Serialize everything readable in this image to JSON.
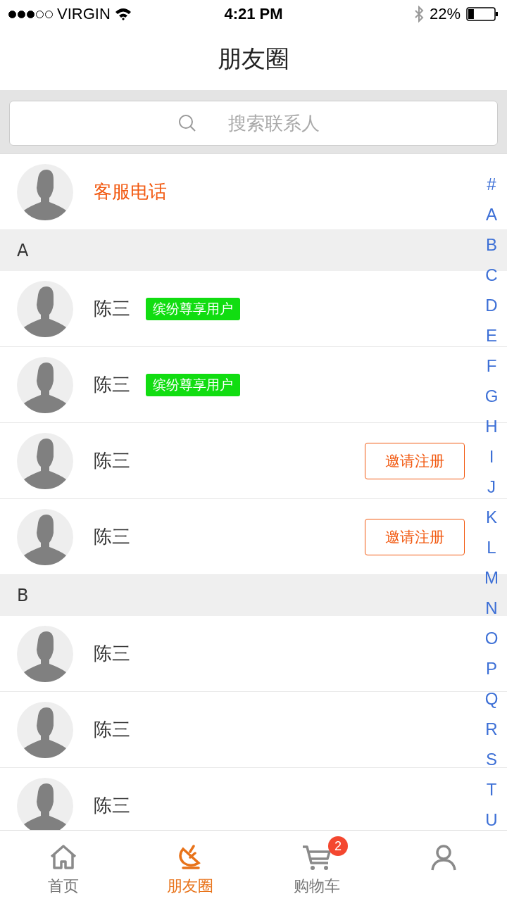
{
  "status_bar": {
    "carrier": "VIRGIN",
    "time": "4:21 PM",
    "battery": "22%"
  },
  "title": "朋友圈",
  "search": {
    "placeholder": "搜索联系人"
  },
  "service": {
    "name": "客服电话"
  },
  "sections": [
    {
      "letter": "A",
      "contacts": [
        {
          "name": "陈三",
          "kind": "member",
          "badge": "缤纷尊享用户"
        },
        {
          "name": "陈三",
          "kind": "member",
          "badge": "缤纷尊享用户"
        },
        {
          "name": "陈三",
          "kind": "invite",
          "button": "邀请注册"
        },
        {
          "name": "陈三",
          "kind": "invite",
          "button": "邀请注册"
        }
      ]
    },
    {
      "letter": "B",
      "contacts": [
        {
          "name": "陈三",
          "kind": "plain"
        },
        {
          "name": "陈三",
          "kind": "plain"
        },
        {
          "name": "陈三",
          "kind": "plain"
        }
      ]
    }
  ],
  "index": [
    "#",
    "A",
    "B",
    "C",
    "D",
    "E",
    "F",
    "G",
    "H",
    "I",
    "J",
    "K",
    "L",
    "M",
    "N",
    "O",
    "P",
    "Q",
    "R",
    "S",
    "T",
    "U"
  ],
  "tabs": [
    {
      "label": "首页",
      "kind": "home",
      "selected": false
    },
    {
      "label": "朋友圈",
      "kind": "moments",
      "selected": true
    },
    {
      "label": "购物车",
      "kind": "cart",
      "selected": false,
      "badge": "2"
    },
    {
      "kind": "profile",
      "selected": false
    }
  ]
}
